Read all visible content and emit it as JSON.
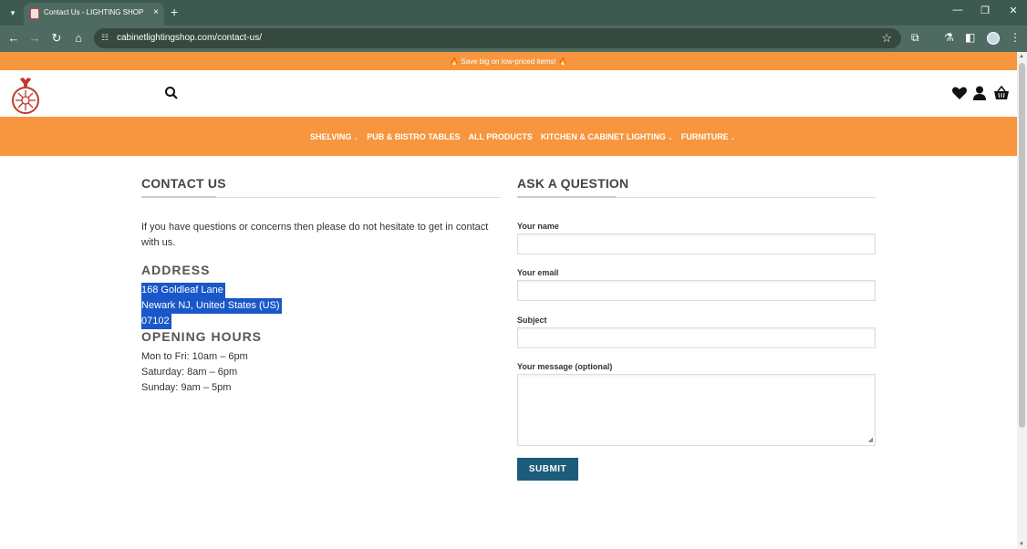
{
  "browser": {
    "tab_title": "Contact Us - LIGHTING SHOP",
    "url": "cabinetlightingshop.com/contact-us/",
    "tab_close": "×",
    "new_tab": "+",
    "minimize": "—",
    "restore": "❐",
    "close": "✕"
  },
  "promo": {
    "text": "🔥 Save big on low-priced items! 🔥"
  },
  "nav": {
    "items": [
      {
        "label": "SHELVING",
        "has_dropdown": true
      },
      {
        "label": "PUB & BISTRO TABLES",
        "has_dropdown": false
      },
      {
        "label": "ALL PRODUCTS",
        "has_dropdown": false
      },
      {
        "label": "KITCHEN & CABINET LIGHTING",
        "has_dropdown": true
      },
      {
        "label": "FURNITURE",
        "has_dropdown": true
      }
    ],
    "chevron": "⌄"
  },
  "contact": {
    "title": "CONTACT US",
    "intro": "If you have questions or concerns then please do not hesitate to get in contact with us.",
    "address_heading": "ADDRESS",
    "address_lines": [
      "168 Goldleaf Lane",
      "Newark NJ, United States (US)",
      "07102"
    ],
    "hours_heading": "OPENING HOURS",
    "hours_lines": [
      "Mon to Fri: 10am – 6pm",
      "Saturday: 8am – 6pm",
      "Sunday: 9am – 5pm"
    ]
  },
  "form": {
    "title": "ASK A QUESTION",
    "name_label": "Your name",
    "email_label": "Your email",
    "subject_label": "Subject",
    "message_label": "Your message (optional)",
    "submit_label": "SUBMIT"
  },
  "colors": {
    "brand_orange": "#f7963e",
    "submit_blue": "#1c5c7a",
    "selection_blue": "#1a57c8",
    "chrome_green": "#4f6b61"
  },
  "icons": [
    "search-icon",
    "heart-icon",
    "user-icon",
    "basket-icon",
    "logo-ornament-icon"
  ]
}
